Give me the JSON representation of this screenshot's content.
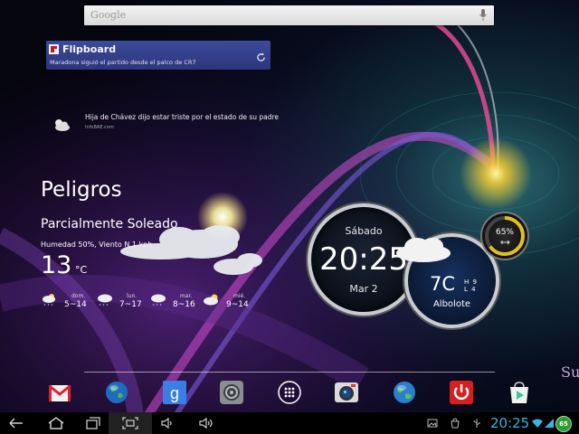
{
  "search": {
    "brand": "Google"
  },
  "flipboard": {
    "title": "Flipboard",
    "headline": "Maradona siguió el partido desde el palco de CR7"
  },
  "news": {
    "title": "Hija de Chávez dijo estar triste por el estado de su padre",
    "source": "InfoBAE.com"
  },
  "weather": {
    "location": "Peligros",
    "condition": "Parcialmente Soleado",
    "details": "Humedad 50%, Viento N 1 kph",
    "temp": "13",
    "unit": "°C",
    "forecast": [
      {
        "day": "dom.",
        "range": "5~14",
        "icon": "partly-rain-icon"
      },
      {
        "day": "lun.",
        "range": "7~17",
        "icon": "rain-icon"
      },
      {
        "day": "mar.",
        "range": "8~16",
        "icon": "rain-icon"
      },
      {
        "day": "mié.",
        "range": "9~14",
        "icon": "partly-cloudy-icon"
      }
    ]
  },
  "clock": {
    "day": "Sábado",
    "time": "20:25",
    "date": "Mar 2"
  },
  "clock_weather": {
    "temp": "7C",
    "high_low": "H 9\nL 4",
    "city": "Albolote"
  },
  "battery": {
    "percent": "65%",
    "level": 0.65
  },
  "partial_text": "Su",
  "dock": [
    "gmail-icon",
    "browser-globe-icon",
    "google-search-icon",
    "settings-icon",
    "app-drawer-icon",
    "camera-icon",
    "globe-icon",
    "power-icon",
    "play-store-icon"
  ],
  "status": {
    "time": "20:25",
    "badge": "65"
  },
  "colors": {
    "accent": "#35b5e5",
    "flipboard": "#3a4796",
    "battery": "#e0c020"
  }
}
